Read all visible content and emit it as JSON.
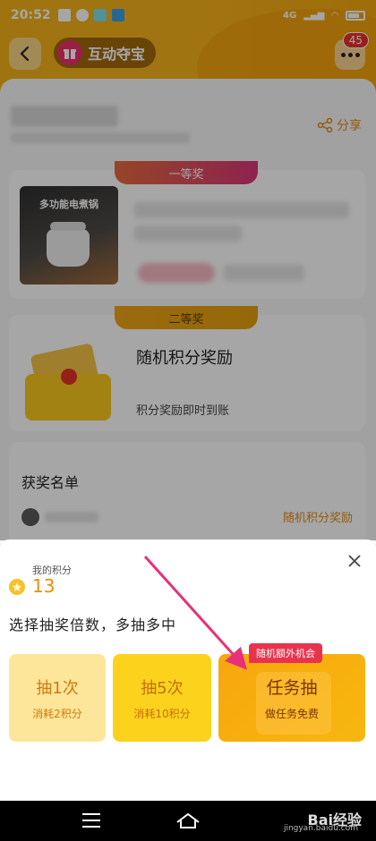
{
  "status": {
    "time": "20:52",
    "network": "4G",
    "badge_count": "45"
  },
  "header": {
    "title": "互动夺宝"
  },
  "share": {
    "label": "分享"
  },
  "prizes": [
    {
      "ribbon": "一等奖",
      "thumb_text": "多功能电煮锅"
    },
    {
      "ribbon": "二等奖",
      "name": "随机积分奖励",
      "desc": "积分奖励即时到账"
    }
  ],
  "winners": {
    "title": "获奖名单",
    "rows": [
      {
        "prize": "随机积分奖励"
      }
    ]
  },
  "sheet": {
    "points_label": "我的积分",
    "points_value": "13",
    "prompt": "选择抽奖倍数，多抽多中",
    "options": [
      {
        "title": "抽1次",
        "sub": "消耗2积分"
      },
      {
        "title": "抽5次",
        "sub": "消耗10积分"
      },
      {
        "title": "任务抽",
        "sub": "做任务免费",
        "tag": "随机额外机会"
      }
    ]
  },
  "colors": {
    "accent": "#f5b21a",
    "tag": "#e8334d",
    "arrow": "#e8307a"
  },
  "watermark": {
    "title": "Bai经验",
    "sub": "jingyan.baidu.com"
  }
}
